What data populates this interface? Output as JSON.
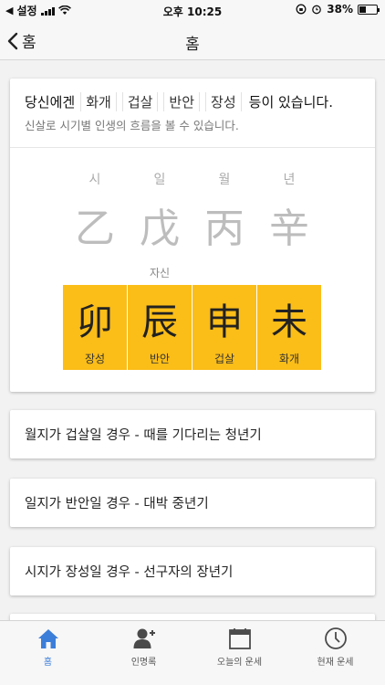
{
  "status": {
    "carrier": "설정",
    "time": "오후 10:25",
    "battery": "38%"
  },
  "nav": {
    "back_label": "홈",
    "title": "홈"
  },
  "main_card": {
    "intro": "당신에겐",
    "tags": [
      "화개",
      "겁살",
      "반안",
      "장성"
    ],
    "suffix": "등이 있습니다.",
    "subtitle": "신살로 시기별 인생의 흐름을 볼 수 있습니다.",
    "columns": [
      {
        "label": "시",
        "stem": "乙",
        "branch": "卯",
        "shinsal": "장성",
        "self": ""
      },
      {
        "label": "일",
        "stem": "戊",
        "branch": "辰",
        "shinsal": "반안",
        "self": "자신"
      },
      {
        "label": "월",
        "stem": "丙",
        "branch": "申",
        "shinsal": "겁살",
        "self": ""
      },
      {
        "label": "년",
        "stem": "辛",
        "branch": "未",
        "shinsal": "화개",
        "self": ""
      }
    ]
  },
  "list": [
    "월지가 겁살일 경우 - 때를 기다리는 청년기",
    "일지가 반안일 경우 - 대박 중년기",
    "시지가 장성일 경우 - 선구자의 장년기"
  ],
  "tabs": [
    {
      "label": "홈",
      "icon": "home-icon"
    },
    {
      "label": "인명록",
      "icon": "add-person-icon"
    },
    {
      "label": "오늘의 운세",
      "icon": "calendar-icon"
    },
    {
      "label": "현재 운세",
      "icon": "clock-icon"
    }
  ],
  "colors": {
    "accent": "#fbbd18",
    "active_tab": "#3b7ed9"
  }
}
